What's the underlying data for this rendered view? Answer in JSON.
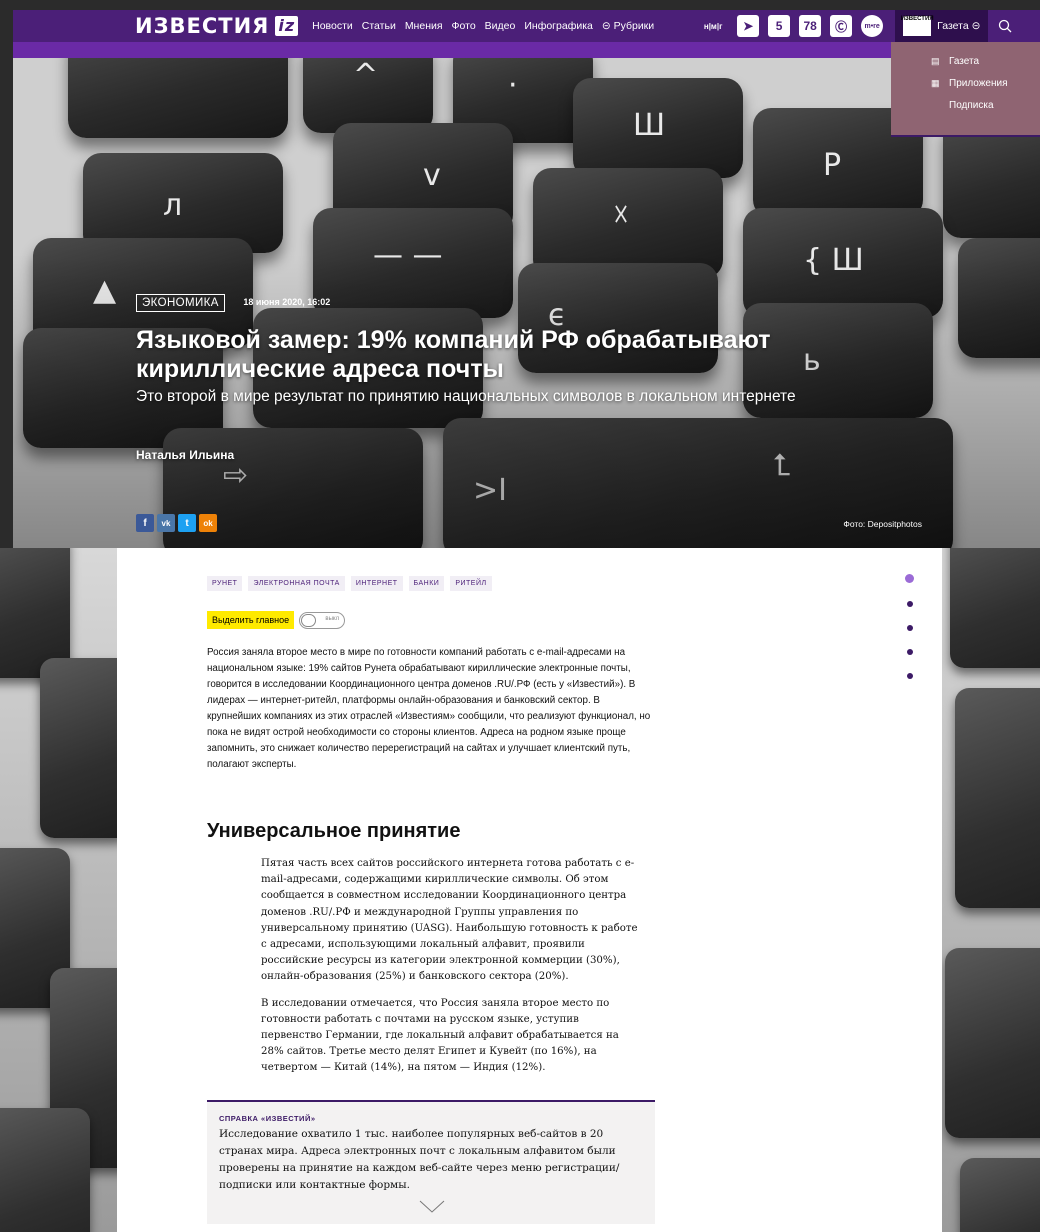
{
  "header": {
    "logo_text": "ИЗВЕСТИЯ",
    "logo_badge": "iz",
    "nav": [
      "Новости",
      "Статьи",
      "Мнения",
      "Фото",
      "Видео",
      "Инфографика",
      "⊝ Рубрики"
    ],
    "partners": [
      "н|м|г",
      "➤",
      "5",
      "78",
      "Ⓒ",
      "m•re"
    ],
    "gazeta_thumb": "ИЗВЕСТИЯ",
    "gazeta_label": "Газета ⊝",
    "accent": "#4b1f78"
  },
  "dropdown": {
    "items": [
      {
        "icon": "newspaper-icon",
        "label": "Газета"
      },
      {
        "icon": "apps-icon",
        "label": "Приложения"
      },
      {
        "icon": "",
        "label": "Подписка"
      }
    ]
  },
  "hero": {
    "rubric": "ЭКОНОМИКА",
    "date": "18 июня 2020, 16:02",
    "headline": "Языковой замер: 19% компаний РФ обрабатывают кириллические адреса почты",
    "subhead": "Это второй в мире результат по принятию национальных символов в локальном интернете",
    "author": "Наталья Ильина",
    "photo_credit": "Фото: Depositphotos",
    "share": [
      "f",
      "vk",
      "t",
      "ok"
    ]
  },
  "article": {
    "tags": [
      "РУНЕТ",
      "ЭЛЕКТРОННАЯ ПОЧТА",
      "ИНТЕРНЕТ",
      "БАНКИ",
      "РИТЕЙЛ"
    ],
    "highlight_label": "Выделить главное",
    "toggle_label": "выкл",
    "lead": "Россия заняла второе место в мире по готовности компаний работать с e-mail-адресами на национальном языке: 19% сайтов Рунета обрабатывают кириллические электронные почты, говорится в исследовании Координационного центра доменов .RU/.РФ (есть у «Известий»). В лидерах — интернет-ритейл, платформы онлайн-образования и банковский сектор. В крупнейших компаниях из этих отраслей «Известиям» сообщили, что реализуют функционал, но пока не видят острой необходимости со стороны клиентов. Адреса на родном языке проще запомнить, это снижает количество перерегистраций на сайтах и улучшает клиентский путь, полагают эксперты.",
    "section_title": "Универсальное принятие",
    "paragraphs": [
      "Пятая часть всех сайтов российского интернета готова работать с e-mail-адресами, содержащими кириллические символы. Об этом сообщается в совместном исследовании Координационного центра доменов .RU/.РФ и международной Группы управления по универсальному принятию (UASG). Наибольшую готовность к работе с адресами, использующими локальный алфавит, проявили российские ресурсы из категории электронной коммерции (30%), онлайн-образования (25%) и банковского сектора (20%).",
      "В исследовании отмечается, что Россия заняла второе место по готовности работать с почтами на русском языке, уступив первенство Германии, где локальный алфавит обрабатывается на 28% сайтов. Третье место делят Египет и Кувейт (по 16%), на четвертом — Китай (14%), на пятом — Индия (12%)."
    ],
    "note_title": "СПРАВКА «ИЗВЕСТИЙ»",
    "note_text": "Исследование охватило 1 тыс. наиболее популярных веб-сайтов в 20 странах мира. Адреса электронных почт с локальным алфавитом были проверены на принятие на каждом веб-сайте через меню регистрации/подписки или контактные формы.",
    "nav_dots": 5,
    "active_dot_color": "#9b6bd6"
  }
}
